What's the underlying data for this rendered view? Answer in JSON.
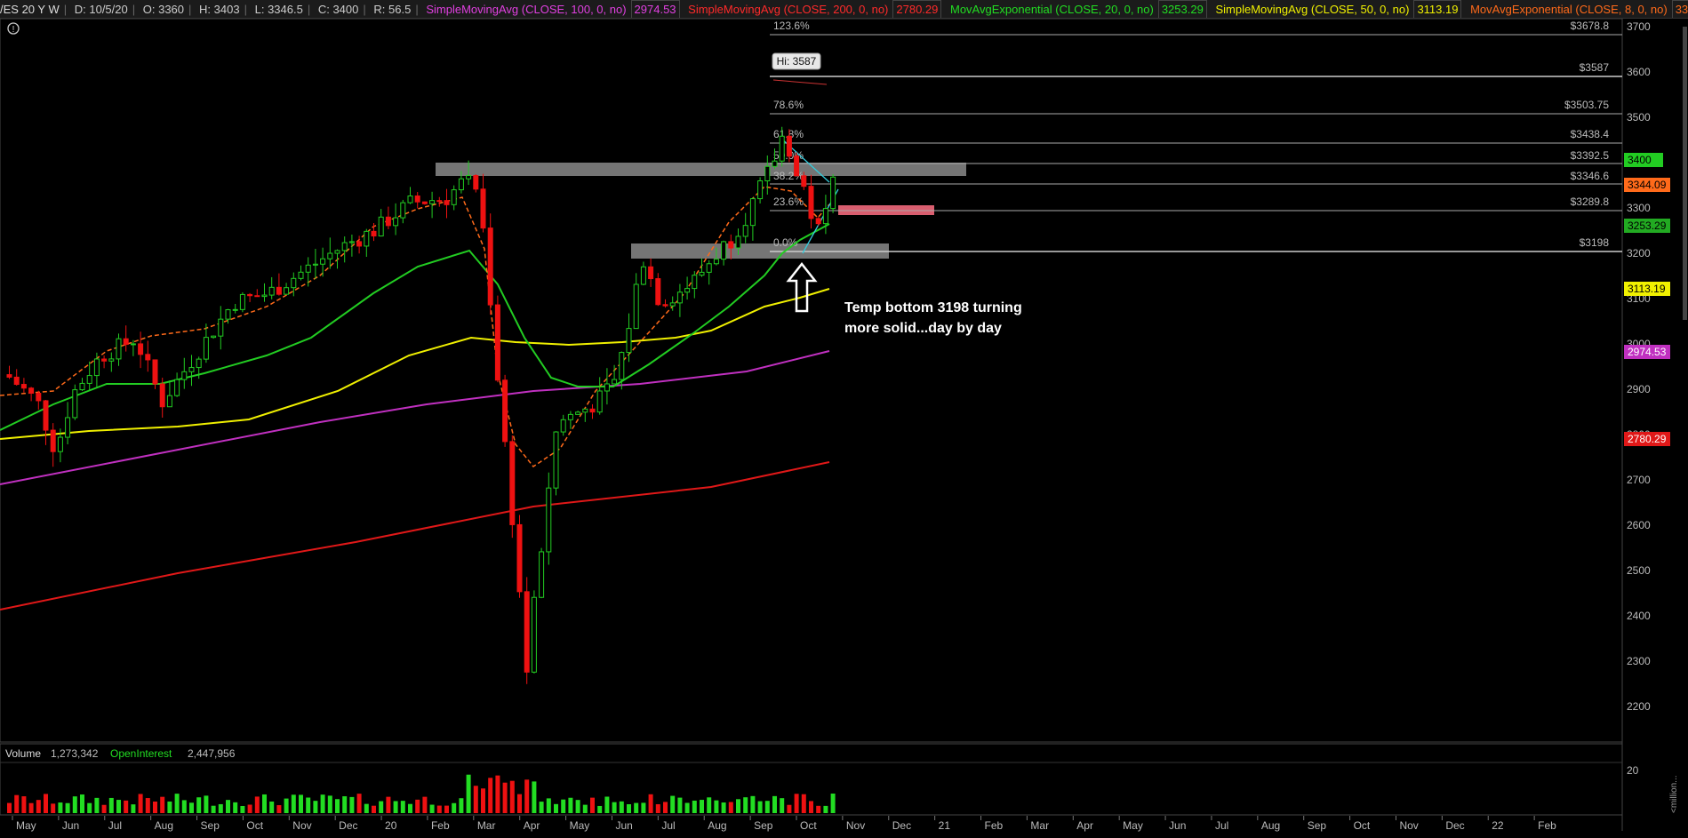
{
  "header": {
    "symbol": "/ES 20 Y W",
    "date": "D: 10/5/20",
    "open": "O: 3360",
    "high": "H: 3403",
    "low": "L: 3346.5",
    "close": "C: 3400",
    "range": "R: 56.5",
    "studies": [
      {
        "label": "SimpleMovingAvg (CLOSE, 100, 0, no)",
        "value": "2974.53",
        "color": "#e040e0"
      },
      {
        "label": "SimpleMovingAvg (CLOSE, 200, 0, no)",
        "value": "2780.29",
        "color": "#ff2a2a"
      },
      {
        "label": "MovAvgExponential (CLOSE, 20, 0, no)",
        "value": "3253.29",
        "color": "#22dd22"
      },
      {
        "label": "SimpleMovingAvg (CLOSE, 50, 0, no)",
        "value": "3113.19",
        "color": "#f0f000"
      },
      {
        "label": "MovAvgExponential (CLOSE, 8, 0, no)",
        "value": "3344.09",
        "color": "#ff6a1a"
      }
    ],
    "more": "..."
  },
  "price_axis": {
    "ticks": [
      "3700",
      "3600",
      "3500",
      "3400",
      "3300",
      "3200",
      "3100",
      "3000",
      "2900",
      "2800",
      "2700",
      "2600",
      "2500",
      "2400",
      "2300",
      "2200"
    ],
    "badges": [
      {
        "text": "3400",
        "bg": "#22cc22",
        "fg": "#000"
      },
      {
        "text": "3344.09",
        "bg": "#ff6a1a",
        "fg": "#000"
      },
      {
        "text": "3253.29",
        "bg": "#22aa22",
        "fg": "#000"
      },
      {
        "text": "3113.19",
        "bg": "#f0f000",
        "fg": "#000"
      },
      {
        "text": "2974.53",
        "bg": "#c030c0",
        "fg": "#fff"
      },
      {
        "text": "2780.29",
        "bg": "#e01818",
        "fg": "#fff"
      }
    ]
  },
  "fib_levels": [
    {
      "pct": "123.6%",
      "price": "$3678.8"
    },
    {
      "pct": "",
      "price": "$3587"
    },
    {
      "pct": "78.6%",
      "price": "$3503.75"
    },
    {
      "pct": "61.8%",
      "price": "$3438.4"
    },
    {
      "pct": "50.0%",
      "price": "$3392.5"
    },
    {
      "pct": "38.2%",
      "price": "$3346.6"
    },
    {
      "pct": "23.6%",
      "price": "$3289.8"
    },
    {
      "pct": "0.0%",
      "price": "$3198"
    }
  ],
  "hi_label": "Hi: 3587",
  "annotation": {
    "line1": "Temp bottom 3198 turning",
    "line2": "more solid...day by day"
  },
  "volume": {
    "label": "Volume",
    "value": "1,273,342",
    "oi_label": "OpenInterest",
    "oi_value": "2,447,956",
    "axis_label": "20",
    "unit_label": "<million..."
  },
  "months": [
    "May",
    "Jun",
    "Jul",
    "Aug",
    "Sep",
    "Oct",
    "Nov",
    "Dec",
    "20",
    "Feb",
    "Mar",
    "Apr",
    "May",
    "Jun",
    "Jul",
    "Aug",
    "Sep",
    "Oct",
    "Nov",
    "Dec",
    "21",
    "Feb",
    "Mar",
    "Apr",
    "May",
    "Jun",
    "Jul",
    "Aug",
    "Sep",
    "Oct",
    "Nov",
    "Dec",
    "22",
    "Feb"
  ]
}
